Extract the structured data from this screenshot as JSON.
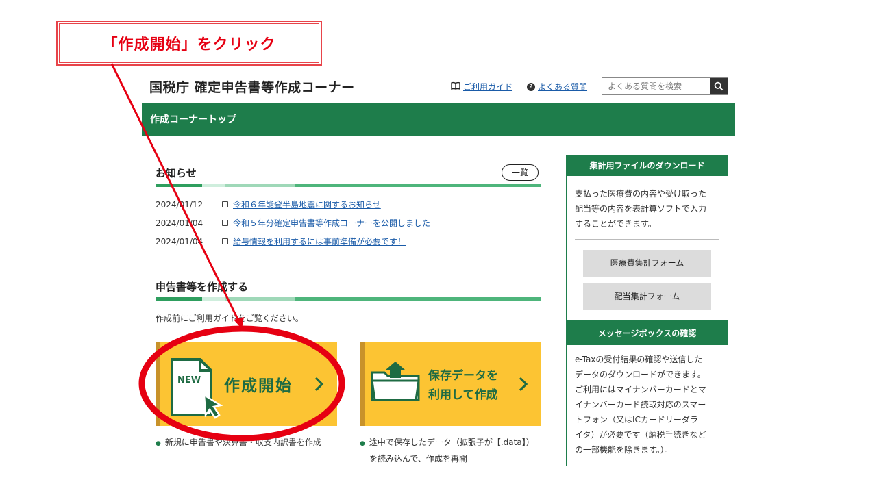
{
  "annotation": {
    "callout_text": "「作成開始」をクリック"
  },
  "header": {
    "site_title": "国税庁 確定申告書等作成コーナー",
    "guide_link": "ご利用ガイド",
    "faq_link": "よくある質問",
    "search_placeholder": "よくある質問を検索"
  },
  "nav": {
    "title": "作成コーナートップ"
  },
  "notices": {
    "title": "お知らせ",
    "list_button": "一覧",
    "items": [
      {
        "date": "2024/01/12",
        "text": "令和６年能登半島地震に関するお知らせ"
      },
      {
        "date": "2024/01/04",
        "text": "令和５年分確定申告書等作成コーナーを公開しました"
      },
      {
        "date": "2024/01/04",
        "text": "給与情報を利用するには事前準備が必要です！"
      }
    ]
  },
  "create": {
    "title": "申告書等を作成する",
    "guide_text": "作成前にご利用ガイドをご覧ください。",
    "start_card": {
      "icon_text": "NEW",
      "label": "作成開始",
      "note": "新規に申告書や決算書・収支内訳書を作成"
    },
    "resume_card": {
      "label_line1": "保存データを",
      "label_line2": "利用して作成",
      "note_line1": "途中で保存したデータ（拡張子が【.data】）",
      "note_line2": "を読み込んで、作成を再開"
    }
  },
  "sidebar": {
    "download": {
      "title": "集計用ファイルのダウンロード",
      "text": [
        "支払った医療費の内容や受け取った",
        "配当等の内容を表計算ソフトで入力",
        "することができます。"
      ],
      "buttons": [
        "医療費集計フォーム",
        "配当集計フォーム"
      ]
    },
    "messagebox": {
      "title": "メッセージボックスの確認",
      "text": [
        "e-Taxの受付結果の確認や送信した",
        "データのダウンロードができます。",
        "ご利用にはマイナンバーカードとマ",
        "イナンバーカード読取対応のスマー",
        "トフォン（又はICカードリーダラ",
        "イタ）が必要です（納税手続きなど",
        "の一部機能を除きます。）。"
      ]
    }
  },
  "colors": {
    "green": "#1e7d4b",
    "yellow": "#fcc433",
    "red": "#e60012",
    "link": "#1a5ba8"
  }
}
